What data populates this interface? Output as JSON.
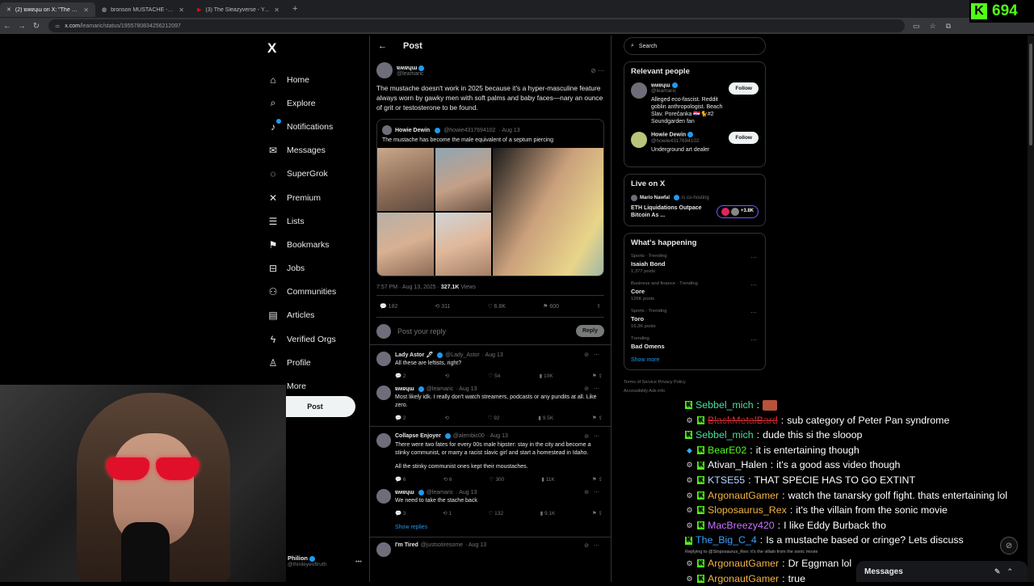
{
  "browser": {
    "tabs": [
      {
        "title": "(2) ɐʍɐɥɯ on X: \"The mustache",
        "icon": "x-icon",
        "active": true
      },
      {
        "title": "bronson MUSTACHE - Google",
        "icon": "google-icon",
        "active": false
      },
      {
        "title": "(3) The Sleazyverse - YouTube",
        "icon": "youtube-icon",
        "active": false
      }
    ],
    "url_host": "x.com",
    "url_path": "/leamaric/status/1955780834256212097"
  },
  "kick": {
    "viewer_count": "694",
    "logo": "K"
  },
  "x_nav": {
    "logo": "X",
    "items": [
      {
        "label": "Home",
        "icon": "home-icon",
        "glyph": "⌂"
      },
      {
        "label": "Explore",
        "icon": "search-icon",
        "glyph": "⌕"
      },
      {
        "label": "Notifications",
        "icon": "bell-icon",
        "glyph": "🔔"
      },
      {
        "label": "Messages",
        "icon": "mail-icon",
        "glyph": "✉"
      },
      {
        "label": "SuperGrok",
        "icon": "grok-icon",
        "glyph": "◌"
      },
      {
        "label": "Premium",
        "icon": "x-premium-icon",
        "glyph": "✕"
      },
      {
        "label": "Lists",
        "icon": "list-icon",
        "glyph": "☰"
      },
      {
        "label": "Bookmarks",
        "icon": "bookmark-icon",
        "glyph": "⚑"
      },
      {
        "label": "Jobs",
        "icon": "briefcase-icon",
        "glyph": "⊟"
      },
      {
        "label": "Communities",
        "icon": "people-icon",
        "glyph": "⚇"
      },
      {
        "label": "Articles",
        "icon": "article-icon",
        "glyph": "▤"
      },
      {
        "label": "Verified Orgs",
        "icon": "lightning-icon",
        "glyph": "ϟ"
      },
      {
        "label": "Profile",
        "icon": "person-icon",
        "glyph": "♙"
      },
      {
        "label": "More",
        "icon": "more-circle-icon",
        "glyph": "⋯"
      }
    ],
    "post_label": "Post",
    "profile_name": "Philion",
    "profile_handle": "@thirdeyeoftruth"
  },
  "post": {
    "header": "Post",
    "author": "ɐʍɐɥɯ",
    "handle": "@leamaric",
    "text": "The mustache doesn't work in 2025 because it's a hyper-masculine feature always worn by gawky men with soft palms and baby faces—nary an ounce of grit or testosterone to be found.",
    "quote": {
      "author": "Howie Dewin",
      "handle": "@howie4317694102",
      "date": "· Aug 13",
      "text": "The mustache has become the male equivalent of a septum piercing"
    },
    "timestamp": "7:57 PM · Aug 13, 2025 ·",
    "views_count": "327.1K",
    "views_label": "Views",
    "stats": {
      "replies": "182",
      "reposts": "311",
      "likes": "6.8K",
      "bookmarks": "600"
    },
    "reply_placeholder": "Post your reply",
    "reply_button": "Reply"
  },
  "replies": [
    {
      "name": "Lady Astor 🖋",
      "handle": "@Lady_Astor",
      "date": "· Aug 13",
      "text": "All these are leftists, right?",
      "replies": "2",
      "reposts": "",
      "likes": "54",
      "views": "10K"
    },
    {
      "name": "ɐʍɐɥɯ",
      "handle": "@leamaric",
      "date": "· Aug 13",
      "text": "Most likely idk. I really don't watch streamers, podcasts or any pundits at all. Like zero.",
      "replies": "2",
      "reposts": "",
      "likes": "92",
      "views": "9.5K"
    },
    {
      "name": "Collapse Enjoyer",
      "handle": "@alembic00",
      "date": "· Aug 13",
      "text": "There were two fates for every 00s male hipster: stay in the city and become a stinky communist, or marry a racist slavic girl and start a homestead in Idaho.",
      "text2": "All the stinky communist ones kept their moustaches.",
      "replies": "6",
      "reposts": "6",
      "likes": "300",
      "views": "11K"
    },
    {
      "name": "ɐʍɐɥɯ",
      "handle": "@leamaric",
      "date": "· Aug 13",
      "text": "We need to take the stache back",
      "replies": "3",
      "reposts": "1",
      "likes": "132",
      "views": "9.1K"
    }
  ],
  "show_replies": "Show replies",
  "last_reply": {
    "name": "I'm Tired",
    "handle": "@justsotiresome",
    "date": "· Aug 13"
  },
  "right": {
    "search_placeholder": "Search",
    "relevant_title": "Relevant people",
    "people": [
      {
        "name": "ɐʍɐɥɯ",
        "handle": "@leamaric",
        "bio": "Alleged eco-fascist. Reddit goblin anthropologist. Beach Slav. Porečanka 🇭🇷🐈#2 Soundgarden fan",
        "follow": "Follow"
      },
      {
        "name": "Howie Dewin",
        "handle": "@howie4317694102",
        "bio": "Underground art dealer",
        "follow": "Follow"
      }
    ],
    "live_title": "Live on X",
    "live_host": "Mario Nawfal",
    "live_status": "is co-hosting",
    "live_title_text": "ETH Liquidations Outpace Bitcoin As ...",
    "live_count": "+3.8K",
    "happening_title": "What's happening",
    "trends": [
      {
        "category": "Sports · Trending",
        "topic": "Isaiah Bond",
        "posts": "1,377 posts"
      },
      {
        "category": "Business and finance · Trending",
        "topic": "Core",
        "posts": "126K posts"
      },
      {
        "category": "Sports · Trending",
        "topic": "Toro",
        "posts": "16.3K posts"
      },
      {
        "category": "Trending",
        "topic": "Bad Omens",
        "posts": ""
      }
    ],
    "show_more": "Show more",
    "footer1": "Terms of Service   Privacy Policy",
    "footer2": "Accessibility   Ads info"
  },
  "chat": [
    {
      "badge": "",
      "user": "Sebbel_mich",
      "color": "#48e0a0",
      "msg": "",
      "emote": true
    },
    {
      "badge": "⚙",
      "user": "BlackMetalBard",
      "color": "#e0303a",
      "msg": "sub category of Peter Pan syndrome",
      "strike": true
    },
    {
      "badge": "",
      "user": "Sebbel_mich",
      "color": "#48e0a0",
      "msg": "dude this si the slooop"
    },
    {
      "badge": "◆",
      "user": "BearE02",
      "color": "#53fc18",
      "msg": "it is entertaining though"
    },
    {
      "badge": "⚙",
      "user": "Ativan_Halen",
      "color": "#ffffff",
      "msg": "it's a good ass video though"
    },
    {
      "badge": "⚙",
      "user": "KTSE55",
      "color": "#b7d7ff",
      "msg": "THAT SPECIE HAS TO GO EXTINT"
    },
    {
      "badge": "⚙",
      "user": "ArgonautGamer",
      "color": "#f5b342",
      "msg": "watch the tanarsky golf fight. thats entertaining lol"
    },
    {
      "badge": "⚙",
      "user": "Sloposaurus_Rex",
      "color": "#f5b342",
      "msg": "it's the villain from the sonic movie"
    },
    {
      "badge": "⚙",
      "user": "MacBreezy420",
      "color": "#c874ff",
      "msg": "I like Eddy Burback tho"
    },
    {
      "badge": "",
      "user": "The_Big_C_4",
      "color": "#3aa0ff",
      "msg": "Is a mustache based or cringe? Lets discuss"
    },
    {
      "badge": "⚙",
      "user": "ArgonautGamer",
      "color": "#f5b342",
      "msg": "Dr Eggman lol",
      "replying": "Replying to @Sloposaurus_Rex: it's the villain from the sonic movie"
    },
    {
      "badge": "⚙",
      "user": "ArgonautGamer",
      "color": "#f5b342",
      "msg": "true"
    }
  ],
  "messages_bar": "Messages"
}
